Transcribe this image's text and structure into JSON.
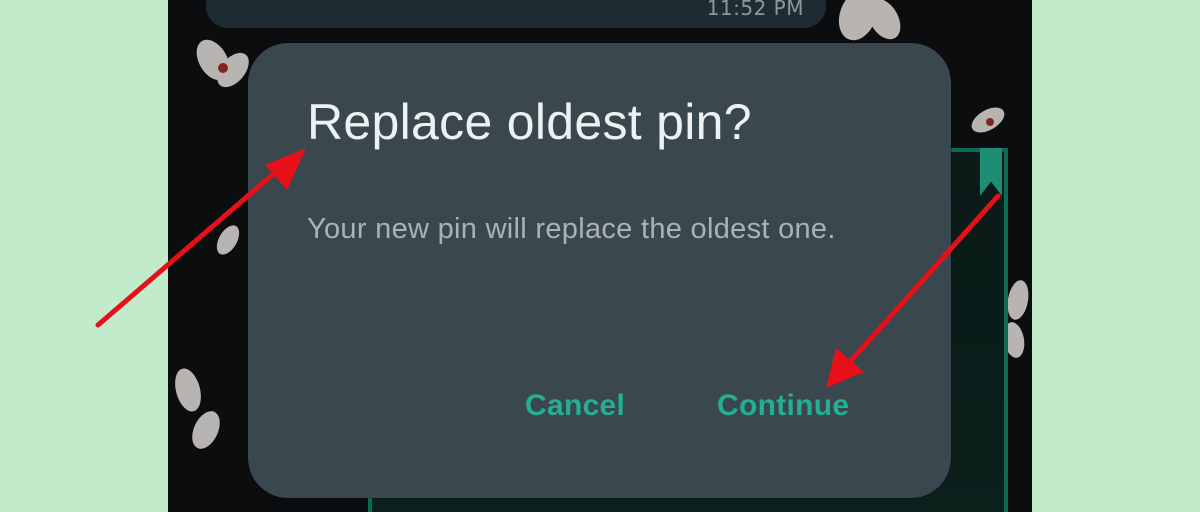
{
  "page": {
    "background_color": "#c2ebcb"
  },
  "chat": {
    "bubble_time": "11:52 PM"
  },
  "dialog": {
    "title": "Replace oldest pin?",
    "message": "Your new pin will replace the oldest one.",
    "cancel_label": "Cancel",
    "continue_label": "Continue"
  },
  "colors": {
    "dialog_bg": "#3a474e",
    "accent_green": "#22b08f",
    "annotation_red": "#e81018"
  },
  "annotations": [
    {
      "type": "arrow",
      "target": "dialog-title",
      "icon": "red-arrow"
    },
    {
      "type": "arrow",
      "target": "continue-button",
      "icon": "red-arrow"
    }
  ]
}
